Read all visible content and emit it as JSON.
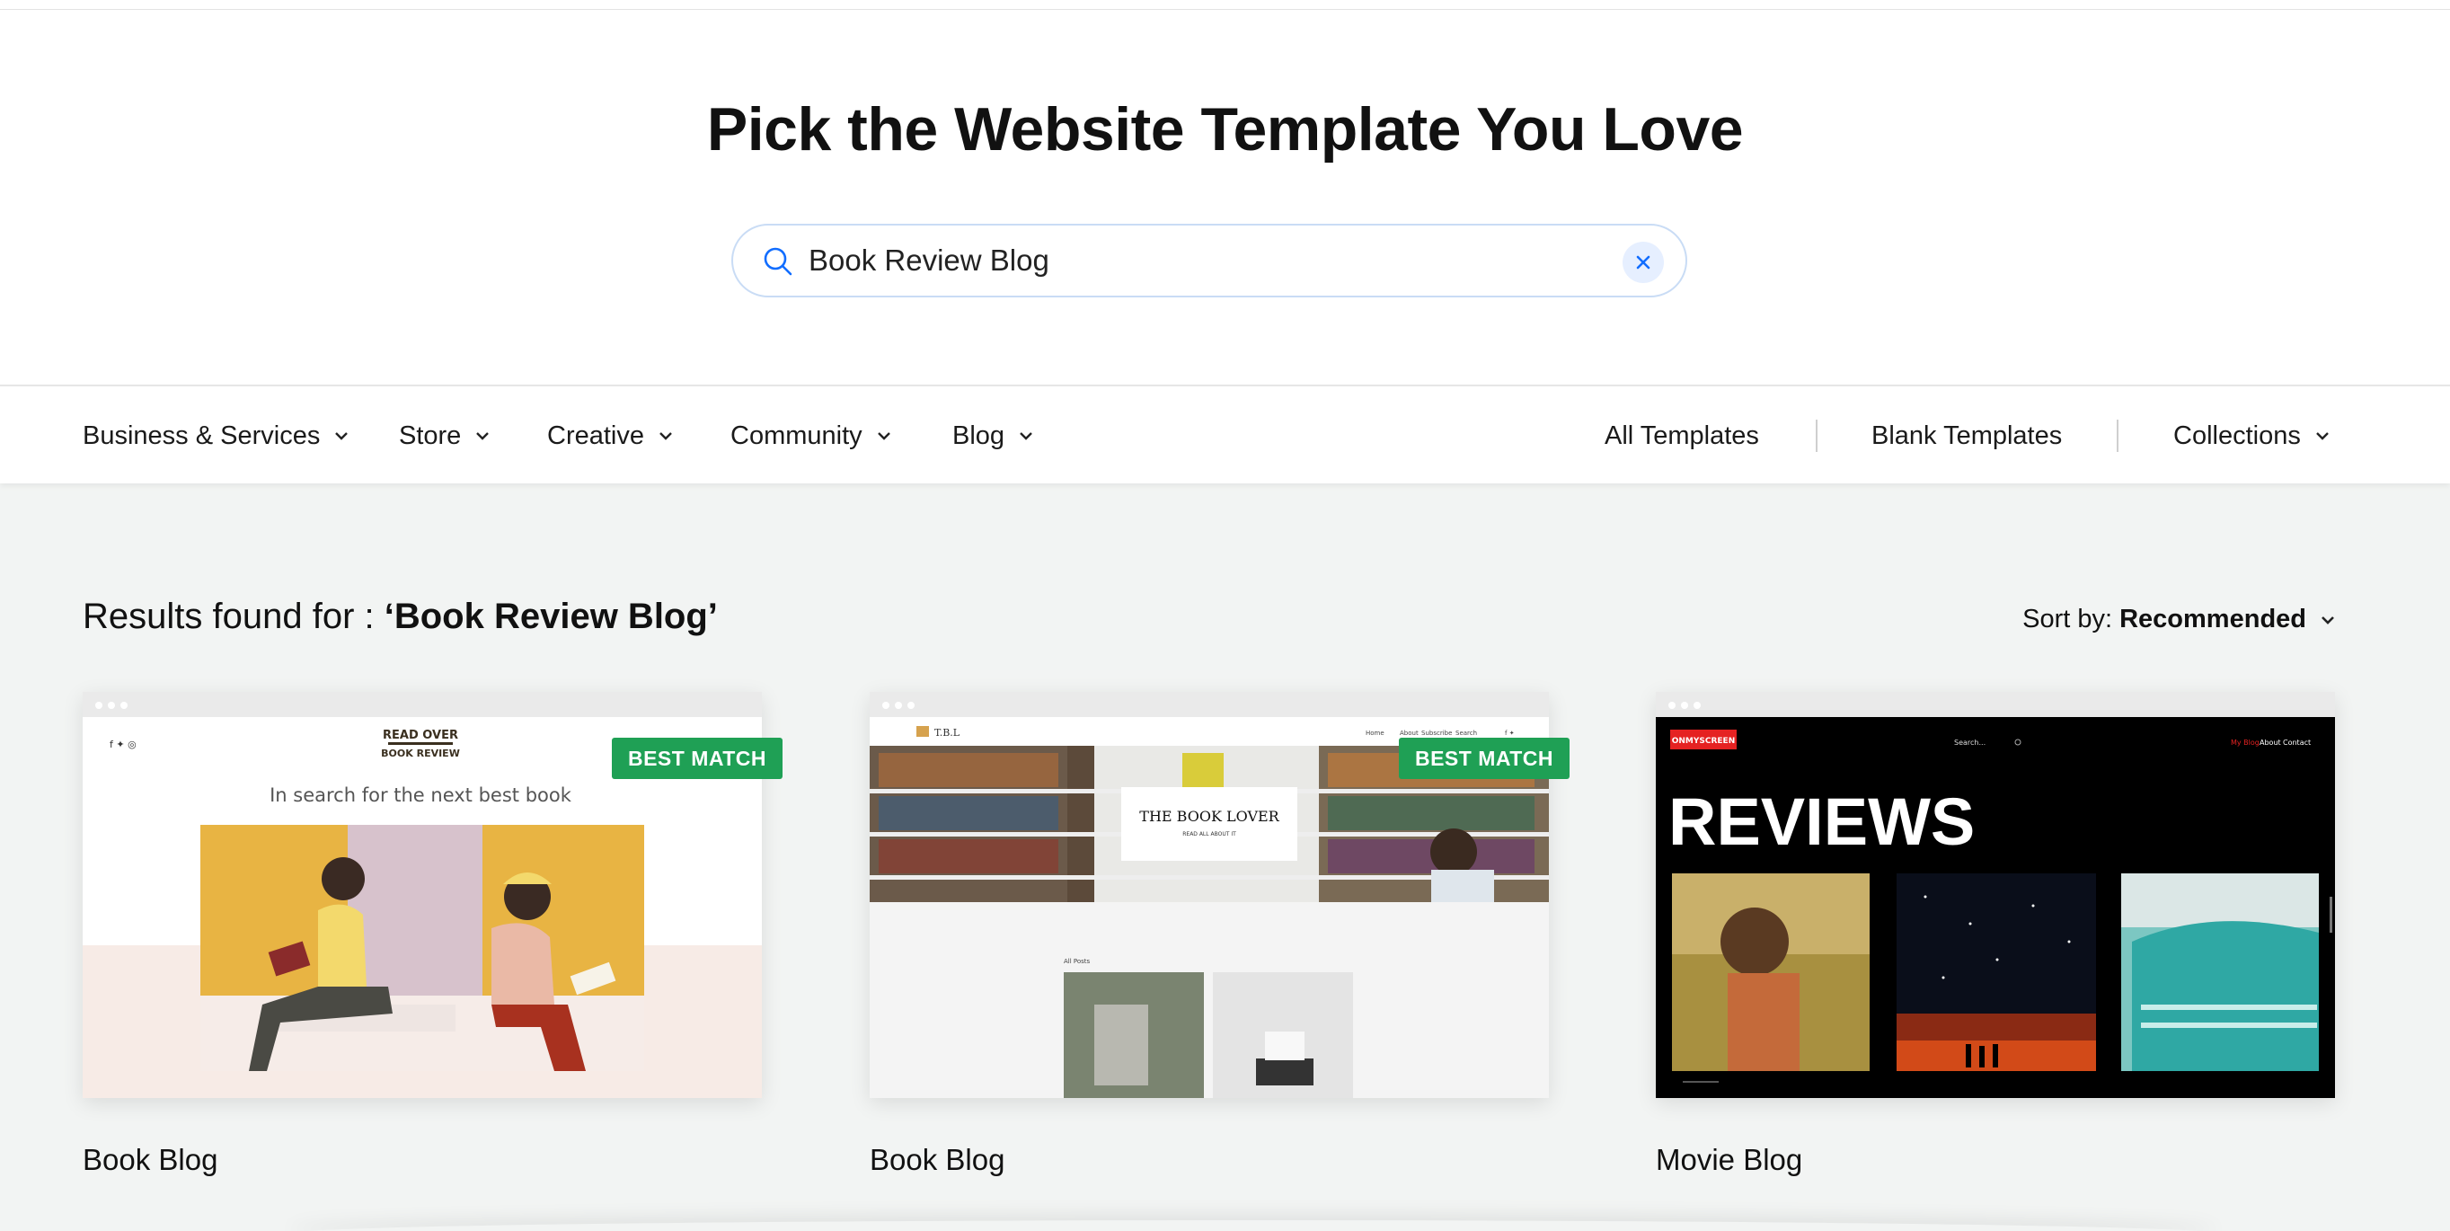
{
  "hero": {
    "title": "Pick the Website Template You Love",
    "search_value": "Book Review Blog"
  },
  "nav": {
    "left": [
      {
        "label": "Business & Services"
      },
      {
        "label": "Store"
      },
      {
        "label": "Creative"
      },
      {
        "label": "Community"
      },
      {
        "label": "Blog"
      }
    ],
    "right": {
      "all": "All Templates",
      "blank": "Blank Templates",
      "collections": "Collections"
    }
  },
  "results": {
    "prefix": "Results found for : ",
    "query": "‘Book Review Blog’",
    "sort_label": "Sort by:",
    "sort_value": "Recommended"
  },
  "badges": {
    "best_match": "BEST MATCH"
  },
  "templates": [
    {
      "title": "Book Blog",
      "preview": {
        "logo_line1": "READ OVER",
        "logo_line2": "BOOK REVIEW",
        "tagline": "In search for the next best book",
        "social": "f ✦ ◎"
      }
    },
    {
      "title": "Book Blog",
      "preview": {
        "logo": "T.B.L",
        "menu": [
          "Home",
          "About",
          "Subscribe",
          "Search",
          "f ✦"
        ],
        "hero_title": "THE BOOK LOVER",
        "hero_sub": "READ ALL ABOUT IT",
        "posts_label": "All Posts"
      }
    },
    {
      "title": "Movie Blog",
      "preview": {
        "logo": "ONMYSCREEN",
        "search": "Search...",
        "menu": [
          "My Blog",
          "About",
          "Contact"
        ],
        "heading": "REVIEWS"
      }
    }
  ],
  "colors": {
    "accent_blue": "#116dff",
    "badge_green": "#1fa055",
    "page_bg": "#f2f4f3"
  }
}
